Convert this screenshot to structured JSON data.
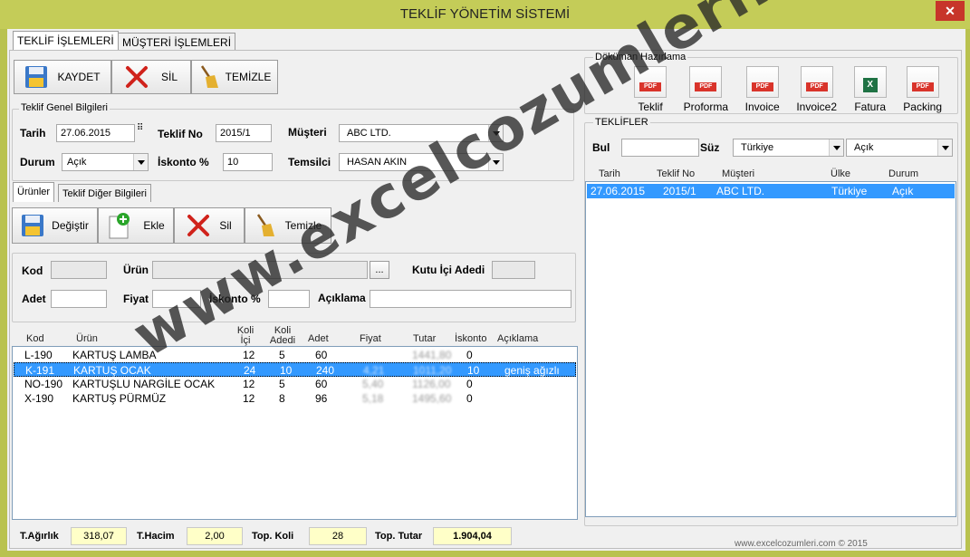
{
  "window": {
    "title": "TEKLİF YÖNETİM SİSTEMİ",
    "close": "✕"
  },
  "tabs": [
    "TEKLİF İŞLEMLERİ",
    "MÜŞTERİ İŞLEMLERİ"
  ],
  "toolbar": {
    "save": "KAYDET",
    "delete": "SİL",
    "clear": "TEMİZLE"
  },
  "general": {
    "legend": "Teklif Genel Bilgileri",
    "date_label": "Tarih",
    "date_value": "27.06.2015",
    "offer_no_label": "Teklif No",
    "offer_no_value": "2015/1",
    "customer_label": "Müşteri",
    "customer_value": "ABC LTD.",
    "status_label": "Durum",
    "status_value": "Açık",
    "discount_label": "İskonto %",
    "discount_value": "10",
    "rep_label": "Temsilci",
    "rep_value": "HASAN AKIN"
  },
  "subtabs": [
    "Ürünler",
    "Teklif Diğer Bilgileri"
  ],
  "product_toolbar": {
    "change": "Değiştir",
    "add": "Ekle",
    "delete": "Sil",
    "clear": "Temizle"
  },
  "product_form": {
    "code_label": "Kod",
    "product_label": "Ürün",
    "browse": "...",
    "box_qty_label": "Kutu İçi Adedi",
    "qty_label": "Adet",
    "price_label": "Fiyat",
    "discount_label": "İskonto %",
    "note_label": "Açıklama"
  },
  "product_table": {
    "headers": [
      "Kod",
      "Ürün",
      "Koli İçi Adet",
      "Koli Adedi",
      "Adet",
      "Fiyat",
      "Tutar",
      "İskonto",
      "Açıklama"
    ],
    "rows": [
      {
        "code": "L-190",
        "product": "KARTUŞ LAMBA",
        "box_qty": "12",
        "boxes": "5",
        "qty": "60",
        "price": "",
        "total": "1441,80",
        "discount": "0",
        "note": ""
      },
      {
        "code": "K-191",
        "product": "KARTUŞ OCAK",
        "box_qty": "24",
        "boxes": "10",
        "qty": "240",
        "price": "4,21",
        "total": "1011,20",
        "discount": "10",
        "note": "geniş ağızlı"
      },
      {
        "code": "NO-190",
        "product": "KARTUŞLU NARGİLE OCAK",
        "box_qty": "12",
        "boxes": "5",
        "qty": "60",
        "price": "5,40",
        "total": "1126,00",
        "discount": "0",
        "note": ""
      },
      {
        "code": "X-190",
        "product": "KARTUŞ PÜRMÜZ",
        "box_qty": "12",
        "boxes": "8",
        "qty": "96",
        "price": "5,18",
        "total": "1495,60",
        "discount": "0",
        "note": ""
      }
    ]
  },
  "totals": {
    "weight_label": "T.Ağırlık",
    "weight_value": "318,07",
    "volume_label": "T.Hacim",
    "volume_value": "2,00",
    "boxes_label": "Top. Koli",
    "boxes_value": "28",
    "amount_label": "Top. Tutar",
    "amount_value": "1.904,04"
  },
  "documents": {
    "legend": "Döküman Hazırlama",
    "items": [
      {
        "label": "Teklif",
        "icon": "pdf-icon",
        "badge": "PDF"
      },
      {
        "label": "Proforma",
        "icon": "pdf-icon",
        "badge": "PDF"
      },
      {
        "label": "Invoice",
        "icon": "pdf-icon",
        "badge": "PDF"
      },
      {
        "label": "Invoice2",
        "icon": "pdf-icon",
        "badge": "PDF"
      },
      {
        "label": "Fatura",
        "icon": "excel-icon",
        "badge": "X"
      },
      {
        "label": "Packing",
        "icon": "pdf-icon",
        "badge": "PDF"
      }
    ]
  },
  "offers": {
    "legend": "TEKLİFLER",
    "search_label": "Bul",
    "filter_label": "Süz",
    "country_value": "Türkiye",
    "status_value": "Açık",
    "headers": [
      "Tarih",
      "Teklif No",
      "Müşteri",
      "Ülke",
      "Durum"
    ],
    "rows": [
      {
        "date": "27.06.2015",
        "no": "2015/1",
        "customer": "ABC LTD.",
        "country": "Türkiye",
        "status": "Açık"
      }
    ]
  },
  "footer": "www.excelcozumleri.com © 2015",
  "watermark": "www.excelcozumleri.com",
  "colors": {
    "titlebar": "#c4cc58",
    "selection": "#3399ff",
    "close": "#c7352a",
    "total_bg": "#ffffc8"
  }
}
